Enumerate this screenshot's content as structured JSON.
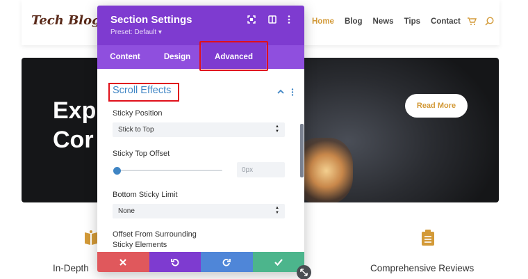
{
  "header": {
    "logo": "Tech Blog",
    "nav": [
      {
        "label": "Home",
        "active": true
      },
      {
        "label": "Blog",
        "active": false
      },
      {
        "label": "News",
        "active": false
      },
      {
        "label": "Tips",
        "active": false
      },
      {
        "label": "Contact",
        "active": false
      }
    ],
    "icons": [
      "cart-icon",
      "search-icon"
    ],
    "accent_color": "#d39a38"
  },
  "hero": {
    "title_lines": [
      "Exp",
      "Cor"
    ],
    "button_label": "Read More"
  },
  "features": [
    {
      "icon": "book-icon",
      "label": "In-Depth"
    },
    {
      "icon": "clipboard-icon",
      "label": "Comprehensive Reviews"
    }
  ],
  "panel": {
    "title": "Section Settings",
    "preset": "Preset: Default ▾",
    "header_icons": [
      "expand-icon",
      "sidebar-icon",
      "more-icon"
    ],
    "header_color": "#7e3bd0",
    "tabs": [
      {
        "label": "Content",
        "active": false
      },
      {
        "label": "Design",
        "active": false
      },
      {
        "label": "Advanced",
        "active": true
      }
    ],
    "section_title": "Scroll Effects",
    "fields": {
      "sticky_position": {
        "label": "Sticky Position",
        "value": "Stick to Top"
      },
      "sticky_top_offset": {
        "label": "Sticky Top Offset",
        "value": "0px",
        "slider_level": 0
      },
      "bottom_sticky_limit": {
        "label": "Bottom Sticky Limit",
        "value": "None"
      },
      "offset_surrounding": {
        "label_lines": [
          "Offset From Surrounding",
          "Sticky Elements"
        ]
      }
    },
    "footer_buttons": [
      {
        "name": "cancel",
        "color": "#e0585c"
      },
      {
        "name": "undo",
        "color": "#7e3bd0"
      },
      {
        "name": "redo",
        "color": "#4f86d8"
      },
      {
        "name": "save",
        "color": "#4cb58c"
      }
    ]
  }
}
